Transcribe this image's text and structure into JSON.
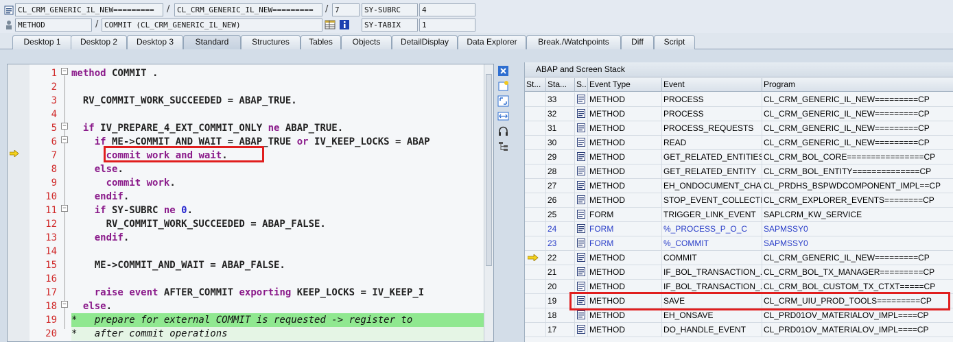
{
  "header": {
    "row1": {
      "program_field": "CL_CRM_GENERIC_IL_NEW=========",
      "include_field": "CL_CRM_GENERIC_IL_NEW=========",
      "line_field": "7",
      "var_name": "SY-SUBRC",
      "var_value": "4"
    },
    "row2": {
      "event_type_field": "METHOD",
      "event_field": "COMMIT (CL_CRM_GENERIC_IL_NEW)",
      "var_name": "SY-TABIX",
      "var_value": "1"
    },
    "separator": "/"
  },
  "tabs": [
    {
      "label": "Desktop 1"
    },
    {
      "label": "Desktop 2"
    },
    {
      "label": "Desktop 3"
    },
    {
      "label": "Standard"
    },
    {
      "label": "Structures"
    },
    {
      "label": "Tables"
    },
    {
      "label": "Objects"
    },
    {
      "label": "DetailDisplay"
    },
    {
      "label": "Data Explorer"
    },
    {
      "label": "Break./Watchpoints"
    },
    {
      "label": "Diff"
    },
    {
      "label": "Script"
    }
  ],
  "active_tab": "Standard",
  "code": {
    "current_line": 7,
    "lines": [
      {
        "n": "1",
        "text": "method COMMIT ."
      },
      {
        "n": "2",
        "text": ""
      },
      {
        "n": "3",
        "text": "  RV_COMMIT_WORK_SUCCEEDED = ABAP_TRUE."
      },
      {
        "n": "4",
        "text": ""
      },
      {
        "n": "5",
        "text": "  if IV_PREPARE_4_EXT_COMMIT_ONLY ne ABAP_TRUE."
      },
      {
        "n": "6",
        "text": "    if ME->COMMIT_AND_WAIT = ABAP_TRUE or IV_KEEP_LOCKS = ABAP"
      },
      {
        "n": "7",
        "text": "      commit work and wait."
      },
      {
        "n": "8",
        "text": "    else."
      },
      {
        "n": "9",
        "text": "      commit work."
      },
      {
        "n": "10",
        "text": "    endif."
      },
      {
        "n": "11",
        "text": "    if SY-SUBRC ne 0."
      },
      {
        "n": "12",
        "text": "      RV_COMMIT_WORK_SUCCEEDED = ABAP_FALSE."
      },
      {
        "n": "13",
        "text": "    endif."
      },
      {
        "n": "14",
        "text": ""
      },
      {
        "n": "15",
        "text": "    ME->COMMIT_AND_WAIT = ABAP_FALSE."
      },
      {
        "n": "16",
        "text": ""
      },
      {
        "n": "17",
        "text": "    raise event AFTER_COMMIT exporting KEEP_LOCKS = IV_KEEP_I"
      },
      {
        "n": "18",
        "text": "  else."
      },
      {
        "n": "19",
        "text": "*   prepare for external COMMIT is requested -> register to"
      },
      {
        "n": "20",
        "text": "*   after commit operations"
      }
    ]
  },
  "stack": {
    "title": "ABAP and Screen Stack",
    "columns": [
      "St...",
      "Sta...",
      "S..",
      "Event Type",
      "Event",
      "Program"
    ],
    "rows": [
      {
        "level": "33",
        "type": "METHOD",
        "event": "PROCESS",
        "program": "CL_CRM_GENERIC_IL_NEW=========CP",
        "blue": false,
        "current": false
      },
      {
        "level": "32",
        "type": "METHOD",
        "event": "PROCESS",
        "program": "CL_CRM_GENERIC_IL_NEW=========CP",
        "blue": false,
        "current": false
      },
      {
        "level": "31",
        "type": "METHOD",
        "event": "PROCESS_REQUESTS",
        "program": "CL_CRM_GENERIC_IL_NEW=========CP",
        "blue": false,
        "current": false
      },
      {
        "level": "30",
        "type": "METHOD",
        "event": "READ",
        "program": "CL_CRM_GENERIC_IL_NEW=========CP",
        "blue": false,
        "current": false
      },
      {
        "level": "29",
        "type": "METHOD",
        "event": "GET_RELATED_ENTITIES",
        "program": "CL_CRM_BOL_CORE================CP",
        "blue": false,
        "current": false
      },
      {
        "level": "28",
        "type": "METHOD",
        "event": "GET_RELATED_ENTITY",
        "program": "CL_CRM_BOL_ENTITY==============CP",
        "blue": false,
        "current": false
      },
      {
        "level": "27",
        "type": "METHOD",
        "event": "EH_ONDOCUMENT_CHA...",
        "program": "CL_PRDHS_BSPWDCOMPONENT_IMPL==CP",
        "blue": false,
        "current": false
      },
      {
        "level": "26",
        "type": "METHOD",
        "event": "STOP_EVENT_COLLECTI...",
        "program": "CL_CRM_EXPLORER_EVENTS========CP",
        "blue": false,
        "current": false
      },
      {
        "level": "25",
        "type": "FORM",
        "event": "TRIGGER_LINK_EVENT",
        "program": "SAPLCRM_KW_SERVICE",
        "blue": false,
        "current": false
      },
      {
        "level": "24",
        "type": "FORM",
        "event": "%_PROCESS_P_O_C",
        "program": "SAPMSSY0",
        "blue": true,
        "current": false
      },
      {
        "level": "23",
        "type": "FORM",
        "event": "%_COMMIT",
        "program": "SAPMSSY0",
        "blue": true,
        "current": false
      },
      {
        "level": "22",
        "type": "METHOD",
        "event": "COMMIT",
        "program": "CL_CRM_GENERIC_IL_NEW=========CP",
        "blue": false,
        "current": true
      },
      {
        "level": "21",
        "type": "METHOD",
        "event": "IF_BOL_TRANSACTION_...",
        "program": "CL_CRM_BOL_TX_MANAGER=========CP",
        "blue": false,
        "current": false
      },
      {
        "level": "20",
        "type": "METHOD",
        "event": "IF_BOL_TRANSACTION_...",
        "program": "CL_CRM_BOL_CUSTOM_TX_CTXT=====CP",
        "blue": false,
        "current": false
      },
      {
        "level": "19",
        "type": "METHOD",
        "event": "SAVE",
        "program": "CL_CRM_UIU_PROD_TOOLS=========CP",
        "blue": false,
        "current": false
      },
      {
        "level": "18",
        "type": "METHOD",
        "event": "EH_ONSAVE",
        "program": "CL_PRD01OV_MATERIALOV_IMPL====CP",
        "blue": false,
        "current": false
      },
      {
        "level": "17",
        "type": "METHOD",
        "event": "DO_HANDLE_EVENT",
        "program": "CL_PRD01OV_MATERIALOV_IMPL====CP",
        "blue": false,
        "current": false
      }
    ]
  },
  "colors": {
    "highlight_red": "#e01e1e",
    "line_number_red": "#d02a2a",
    "keyword_purple": "#8a1a8a",
    "comment_green": "#90e890",
    "system_blue": "#2a3ec8"
  },
  "icons": [
    "doc-icon",
    "method-icon",
    "table-icon",
    "info-icon",
    "close-icon",
    "new-icon",
    "fullscreen-icon",
    "split-icon",
    "headset-icon",
    "hierarchy-icon",
    "current-arrow-icon",
    "event-type-icon"
  ]
}
